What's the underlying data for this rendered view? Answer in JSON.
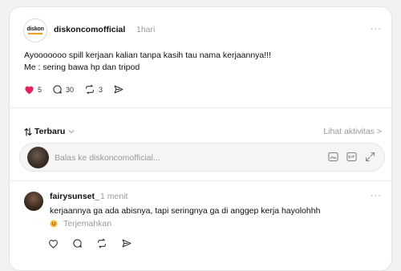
{
  "post": {
    "author": "diskoncomofficial",
    "logo_text": "diskon",
    "time": "1hari",
    "more": "···",
    "lines": [
      "Ayooooooo spill kerjaan kalian tanpa kasih tau nama kerjaannya!!!",
      "Me : sering bawa hp dan tripod"
    ],
    "likes": "5",
    "comments": "30",
    "reposts": "3",
    "like_color": "#e0245e"
  },
  "replies_header": {
    "sort_label": "Terbaru",
    "activity_label": "Lihat aktivitas >"
  },
  "reply_box": {
    "placeholder": "Balas ke diskoncomofficial..."
  },
  "comment": {
    "author": "fairysunset_",
    "time": "1 menit",
    "more": "···",
    "text": "kerjaannya ga ada abisnya, tapi seringnya ga di anggep kerja hayolohhh",
    "translate_label": "Terjemahkan"
  },
  "icons": [
    "heart-icon",
    "comment-icon",
    "repost-icon",
    "share-icon",
    "sort-icon",
    "chevron-down-icon",
    "image-icon",
    "gif-icon",
    "expand-icon",
    "more-icon"
  ]
}
